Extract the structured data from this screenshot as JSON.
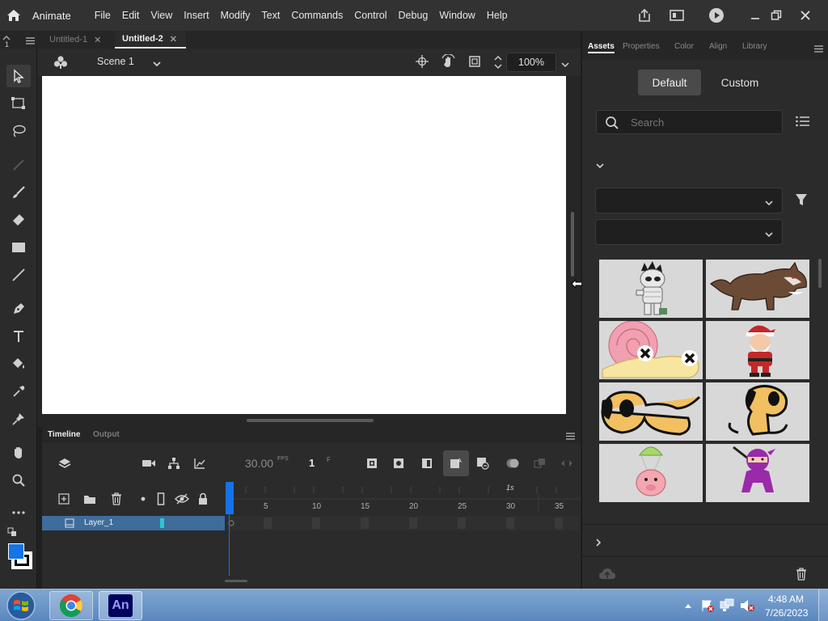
{
  "app": {
    "name": "Animate"
  },
  "menu": [
    "File",
    "Edit",
    "View",
    "Insert",
    "Modify",
    "Text",
    "Commands",
    "Control",
    "Debug",
    "Window",
    "Help"
  ],
  "doc_tabs": [
    {
      "label": "Untitled-1",
      "active": false
    },
    {
      "label": "Untitled-2",
      "active": true
    }
  ],
  "scene": {
    "label": "Scene 1",
    "zoom": "100%"
  },
  "tool_indicator": "1",
  "timeline": {
    "tabs": [
      "Timeline",
      "Output"
    ],
    "fps": "30.00",
    "fps_unit": "FPS",
    "frame": "1",
    "frame_unit": "F",
    "seconds_marker": "1s",
    "ruler": [
      "5",
      "10",
      "15",
      "20",
      "25",
      "30",
      "35"
    ],
    "layer_name": "Layer_1"
  },
  "panel": {
    "tabs": [
      "Assets",
      "Properties",
      "Color",
      "Align",
      "Library"
    ],
    "toggle_default": "Default",
    "toggle_custom": "Custom",
    "search_placeholder": "Search",
    "assets": [
      {
        "name": "mummy-character"
      },
      {
        "name": "werewolf-character"
      },
      {
        "name": "pink-snail-character"
      },
      {
        "name": "santa-character"
      },
      {
        "name": "dog-lying-character"
      },
      {
        "name": "dog-sitting-character"
      },
      {
        "name": "pig-parachute-character"
      },
      {
        "name": "ninja-character"
      }
    ]
  },
  "taskbar": {
    "time": "4:48 AM",
    "date": "7/26/2023",
    "apps": [
      "start",
      "chrome",
      "animate"
    ],
    "animate_label": "An"
  },
  "colors": {
    "accent": "#1473e6",
    "layer_row": "#3e6d9c",
    "stroke": "#000000",
    "fill": "#1473e6",
    "layer_color": "#26c8d8"
  }
}
